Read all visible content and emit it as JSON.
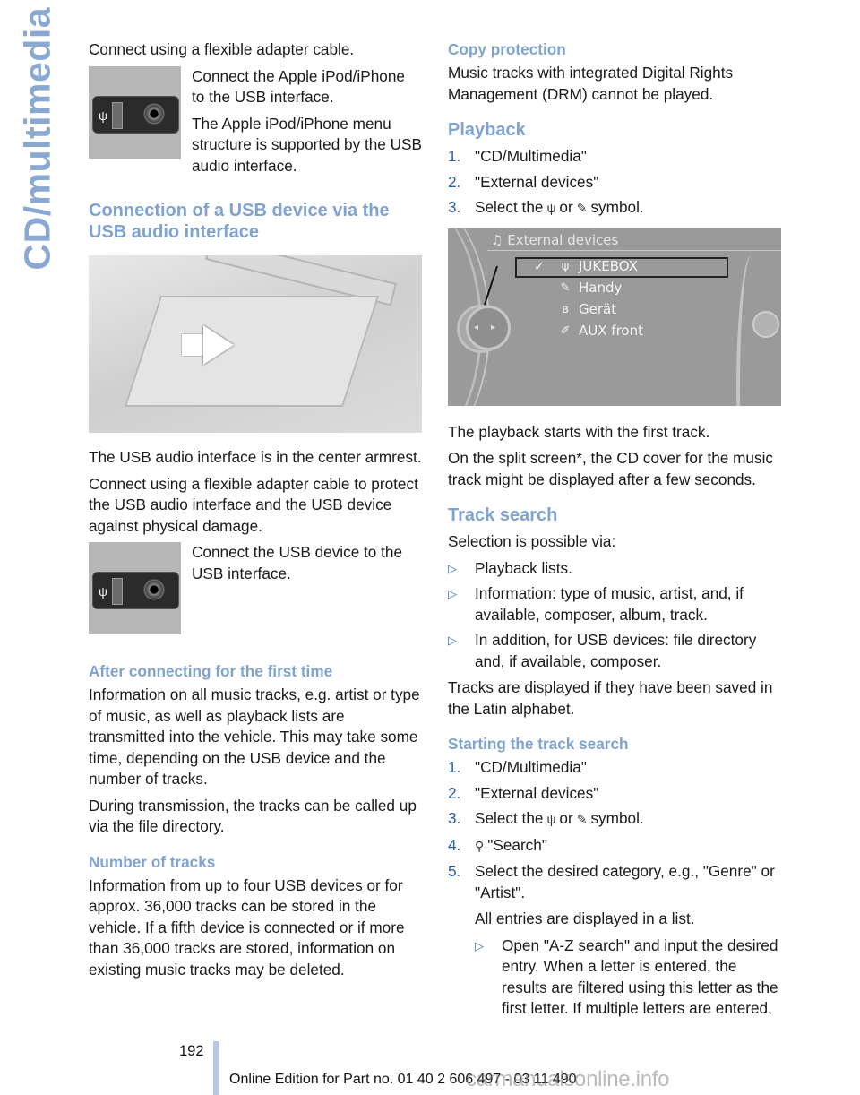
{
  "side_tab": {
    "label": "CD/multimedia"
  },
  "left": {
    "intro": "Connect using a flexible adapter cable.",
    "ipod_block": {
      "image_icon": "usb-aux-port-image",
      "p1": "Connect the Apple iPod/iPhone to the USB interface.",
      "p2": "The Apple iPod/iPhone menu structure is supported by the USB audio interface."
    },
    "usb_section": {
      "heading": "Connection of a USB device via the USB audio interface",
      "photo": "center-armrest-photo",
      "p1": "The USB audio interface is in the center armrest.",
      "p2": "Connect using a flexible adapter cable to protect the USB audio interface and the USB device against physical damage.",
      "connect_text": "Connect the USB device to the USB interface."
    },
    "first_time": {
      "heading": "After connecting for the first time",
      "p1": "Information on all music tracks, e.g. artist or type of music, as well as playback lists are transmitted into the vehicle. This may take some time, depending on the USB device and the number of tracks.",
      "p2": "During transmission, the tracks can be called up via the file directory."
    },
    "num_tracks": {
      "heading": "Number of tracks",
      "p1": "Information from up to four USB devices or for approx. 36,000 tracks can be stored in the vehicle. If a fifth device is connected or if more than 36,000 tracks are stored, information on existing music tracks may be deleted."
    }
  },
  "right": {
    "copy_protection": {
      "heading": "Copy protection",
      "p1": "Music tracks with integrated Digital Rights Management (DRM) cannot be played."
    },
    "playback": {
      "heading": "Playback",
      "steps": [
        {
          "num": "1.",
          "text": "\"CD/Multimedia\""
        },
        {
          "num": "2.",
          "text": "\"External devices\""
        },
        {
          "num": "3.",
          "pre": "Select the",
          "mid": "or",
          "post": "symbol."
        }
      ],
      "after1": "The playback starts with the first track.",
      "after2": "On the split screen*, the CD cover for the music track might be displayed after a few seconds."
    },
    "screen": {
      "title": "External devices",
      "items": [
        {
          "check": "✓",
          "icon": "usb-icon",
          "glyph": "ψ",
          "label": "JUKEBOX",
          "selected": true
        },
        {
          "check": "",
          "icon": "phone-cradle-icon",
          "glyph": "✎",
          "label": "Handy",
          "selected": false
        },
        {
          "check": "",
          "icon": "bluetooth-icon",
          "glyph": "ʙ",
          "label": "Gerät",
          "selected": false
        },
        {
          "check": "",
          "icon": "aux-plug-icon",
          "glyph": "✐",
          "label": "AUX front",
          "selected": false
        }
      ]
    },
    "track_search": {
      "heading": "Track search",
      "intro": "Selection is possible via:",
      "bullets": [
        "Playback lists.",
        "Information: type of music, artist, and, if available, composer, album, track.",
        "In addition, for USB devices: file directory and, if available, composer."
      ],
      "note": "Tracks are displayed if they have been saved in the Latin alphabet."
    },
    "starting_search": {
      "heading": "Starting the track search",
      "steps": [
        {
          "num": "1.",
          "text": "\"CD/Multimedia\""
        },
        {
          "num": "2.",
          "text": "\"External devices\""
        },
        {
          "num": "3.",
          "pre": "Select the",
          "mid": "or",
          "post": "symbol."
        },
        {
          "num": "4.",
          "text": "\"Search\""
        },
        {
          "num": "5.",
          "text": "Select the desired category, e.g., \"Genre\" or \"Artist\"."
        }
      ],
      "sub_note": "All entries are displayed in a list.",
      "sub_bullets": [
        "Open \"A-Z search\" and input the desired entry. When a letter is entered, the results are filtered using this letter as the first letter. If multiple letters are entered,"
      ]
    }
  },
  "footer": {
    "page_number": "192",
    "edition": "Online Edition for Part no. 01 40 2 606 497 - 03 11 490",
    "watermark": "carmanualsonline.info"
  },
  "colors": {
    "heading": "#7fa3d1",
    "list_number": "#2b5fa6",
    "side_tab": "#8aa9d2",
    "footer_bar": "#b9c8e2"
  }
}
